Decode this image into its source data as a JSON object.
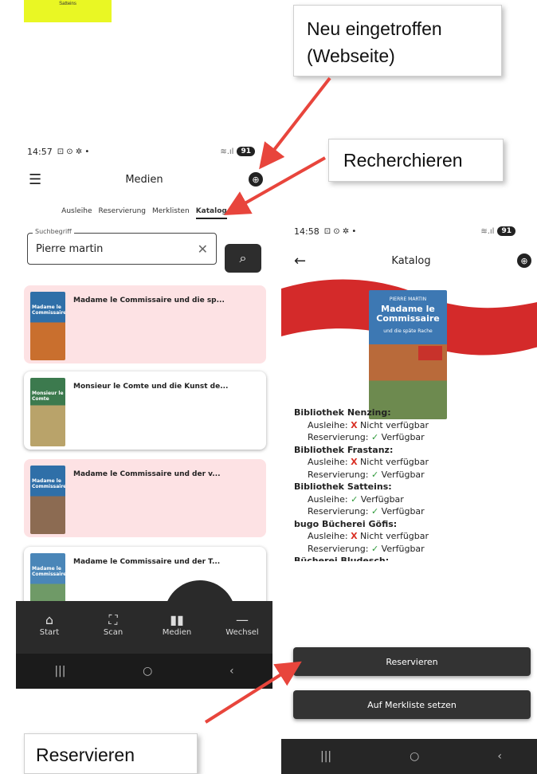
{
  "top_strip": {
    "text": "Satteins"
  },
  "callouts": {
    "new_arrivals": [
      "Neu eingetroffen",
      "(Webseite)"
    ],
    "research": "Recherchieren",
    "reserve": "Reservieren"
  },
  "left_phone": {
    "status": {
      "time": "14:57",
      "icons": "⊡ ⊙ ✲ •",
      "signal": "≋.ıl",
      "battery": "91"
    },
    "appbar": {
      "title": "Medien"
    },
    "tabs": [
      "Ausleihe",
      "Reservierung",
      "Merklisten",
      "Katalog"
    ],
    "search": {
      "legend": "Suchbegriff",
      "value": "Pierre martin"
    },
    "results": [
      {
        "title": "Madame le Commissaire und die sp...",
        "cover_text": "Madame le Commissaire",
        "cover_color": "#2f6fa8",
        "highlight": true
      },
      {
        "title": "Monsieur le Comte und die Kunst de...",
        "cover_text": "Monsieur le Comte",
        "cover_color": "#3c7a4e",
        "highlight": false
      },
      {
        "title": "Madame le Commissaire und der v...",
        "cover_text": "Madame le Commissaire",
        "cover_color": "#2f6fa8",
        "highlight": true
      },
      {
        "title": "Madame le Commissaire und der T...",
        "cover_text": "Madame le Commissaire",
        "cover_color": "#4a86b8",
        "highlight": false
      }
    ],
    "bottom_nav": [
      "Start",
      "Scan",
      "Medien",
      "Wechsel"
    ]
  },
  "right_phone": {
    "status": {
      "time": "14:58",
      "icons": "⊡ ⊙ ✲ •",
      "signal": "≋.ıl",
      "battery": "91"
    },
    "appbar": {
      "title": "Katalog"
    },
    "cover": {
      "author": "PIERRE MARTIN",
      "title": "Madame le Commissaire",
      "subtitle": "und die späte Rache"
    },
    "libraries": [
      {
        "name": "Bibliothek Nenzing:",
        "loan_label": "Ausleihe:",
        "loan": "Nicht verfügbar",
        "loan_ok": false,
        "res_label": "Reservierung:",
        "res": "Verfügbar",
        "res_ok": true
      },
      {
        "name": "Bibliothek Frastanz:",
        "loan_label": "Ausleihe:",
        "loan": "Nicht verfügbar",
        "loan_ok": false,
        "res_label": "Reservierung:",
        "res": "Verfügbar",
        "res_ok": true
      },
      {
        "name": "Bibliothek Satteins:",
        "loan_label": "Ausleihe:",
        "loan": "Verfügbar",
        "loan_ok": true,
        "res_label": "Reservierung:",
        "res": "Verfügbar",
        "res_ok": true
      },
      {
        "name": "bugo Bücherei Göfis:",
        "loan_label": "Ausleihe:",
        "loan": "Nicht verfügbar",
        "loan_ok": false,
        "res_label": "Reservierung:",
        "res": "Verfügbar",
        "res_ok": true
      }
    ],
    "partial_library": "Bücherei Bludesch:",
    "buttons": {
      "reserve": "Reservieren",
      "watchlist": "Auf Merkliste setzen"
    }
  },
  "colors": {
    "arrow": "#e8453c",
    "banner": "#d42a2a",
    "highlight": "#fde2e4",
    "dark": "#2a2a2a"
  }
}
